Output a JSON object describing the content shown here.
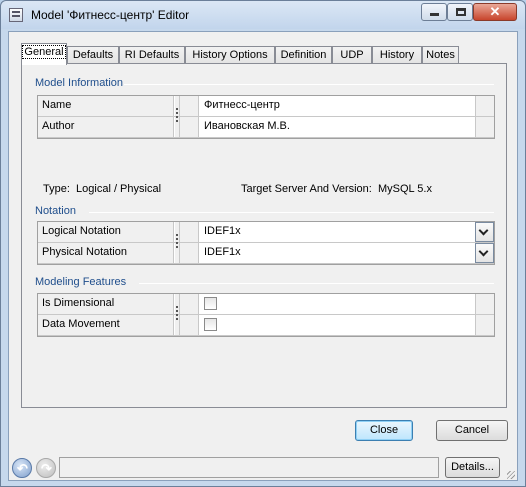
{
  "window": {
    "title": "Model 'Фитнесс-центр' Editor"
  },
  "tabs": [
    {
      "label": "General",
      "active": true
    },
    {
      "label": "Defaults",
      "active": false
    },
    {
      "label": "RI Defaults",
      "active": false
    },
    {
      "label": "History Options",
      "active": false
    },
    {
      "label": "Definition",
      "active": false
    },
    {
      "label": "UDP",
      "active": false
    },
    {
      "label": "History",
      "active": false
    },
    {
      "label": "Notes",
      "active": false
    }
  ],
  "sections": {
    "model_information": "Model Information",
    "notation": "Notation",
    "modeling_features": "Modeling Features"
  },
  "model_info": {
    "name_label": "Name",
    "name_value": "Фитнесс-центр",
    "author_label": "Author",
    "author_value": "Ивановская М.В."
  },
  "type_line": {
    "type_label": "Type:",
    "type_value": "Logical / Physical",
    "target_label": "Target Server And Version:",
    "target_value": "MySQL 5.x"
  },
  "notation": {
    "logical_label": "Logical Notation",
    "logical_value": "IDEF1x",
    "physical_label": "Physical Notation",
    "physical_value": "IDEF1x"
  },
  "features": {
    "dimensional_label": "Is Dimensional",
    "dimensional_checked": false,
    "data_movement_label": "Data Movement",
    "data_movement_checked": false
  },
  "buttons": {
    "close": "Close",
    "cancel": "Cancel",
    "details": "Details..."
  },
  "colors": {
    "section_title": "#1f4e8c",
    "window_frame": "#c6d8ec",
    "close_caption": "#c8452c"
  }
}
